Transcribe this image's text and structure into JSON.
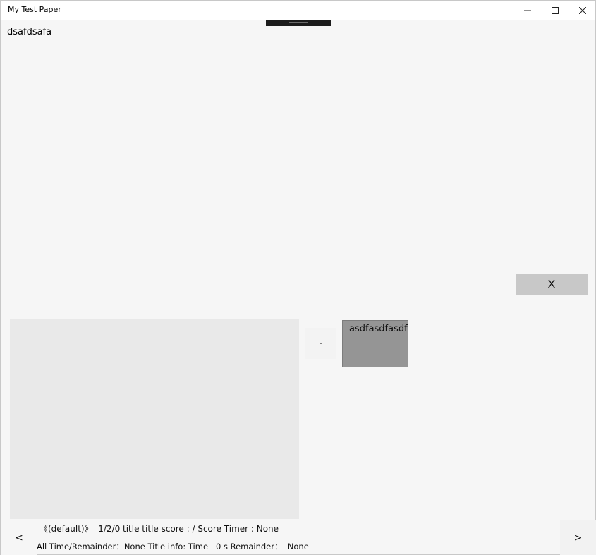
{
  "window": {
    "title": "My Test Paper"
  },
  "question": {
    "text": "dsafdsafa"
  },
  "controls": {
    "close_label": "X",
    "minus_label": "-",
    "prev_label": "<",
    "next_label": ">"
  },
  "options": [
    {
      "label": "asdfasdfasdf"
    }
  ],
  "status": {
    "line1": "《(default)》  1/2/0 title title score : / Score Timer : None",
    "line2": "All Time/Remainder：None Title info: Time   0 s Remainder：  None"
  },
  "icons": {
    "minimize": "minimize-icon",
    "maximize": "maximize-icon",
    "close": "close-icon"
  }
}
